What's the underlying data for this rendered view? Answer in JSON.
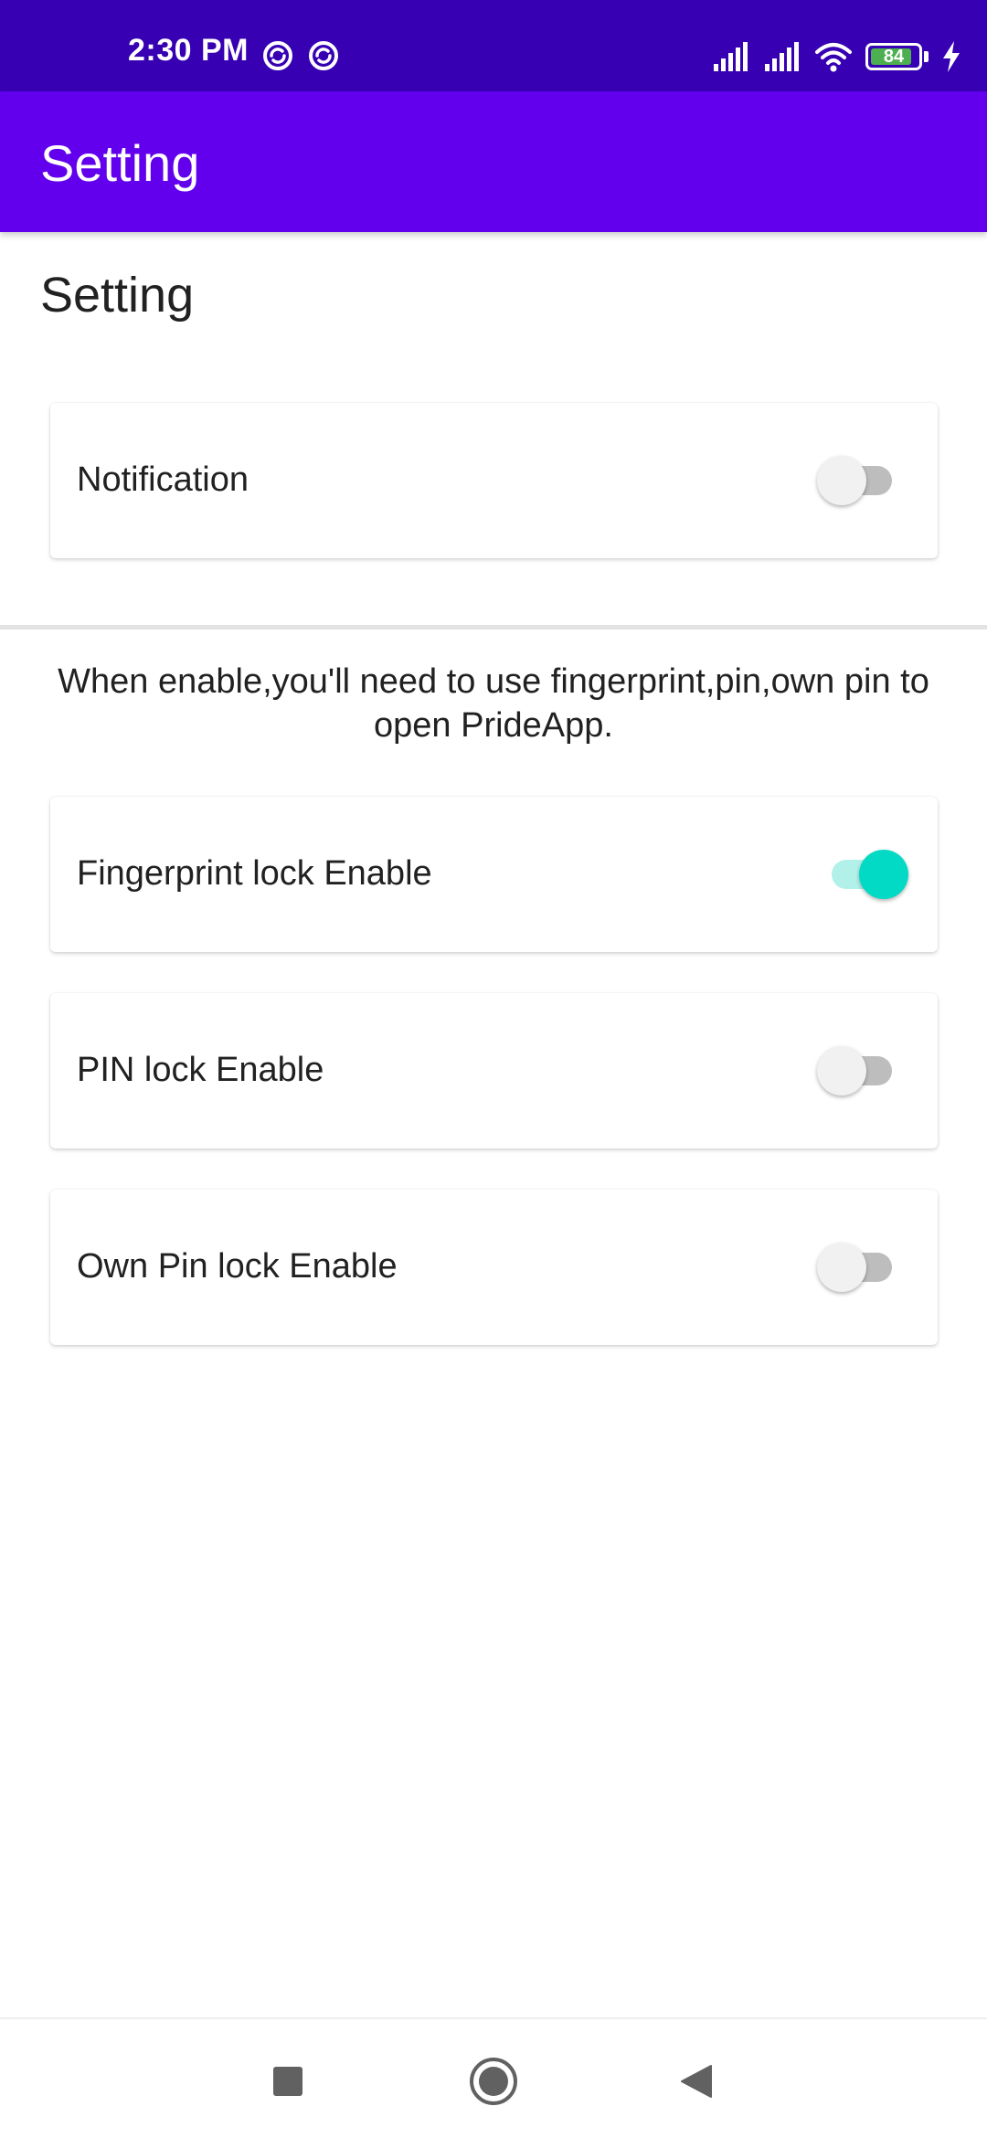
{
  "status_bar": {
    "time": "2:30 PM",
    "icons": [
      "sync-icon",
      "sync-icon",
      "signal-icon",
      "signal-icon",
      "wifi-icon",
      "battery-icon",
      "charging-icon"
    ],
    "battery_level": "84"
  },
  "app_bar": {
    "title": "Setting"
  },
  "content": {
    "heading": "Setting",
    "notification": {
      "label": "Notification",
      "enabled": false
    },
    "description": "When enable,you'll need to use fingerprint,pin,own pin to open PrideApp.",
    "lock_options": [
      {
        "label": "Fingerprint lock Enable",
        "enabled": true
      },
      {
        "label": "PIN lock Enable",
        "enabled": false
      },
      {
        "label": "Own Pin lock Enable",
        "enabled": false
      }
    ]
  },
  "nav_bar": {
    "icons": [
      "recents-square-icon",
      "home-circle-icon",
      "back-triangle-icon"
    ]
  },
  "colors": {
    "status_bar": "#3700b3",
    "app_bar": "#6200ee",
    "switch_on": "#03dac5",
    "switch_on_track": "#b2f1ea",
    "battery_fill": "#4caf50"
  }
}
